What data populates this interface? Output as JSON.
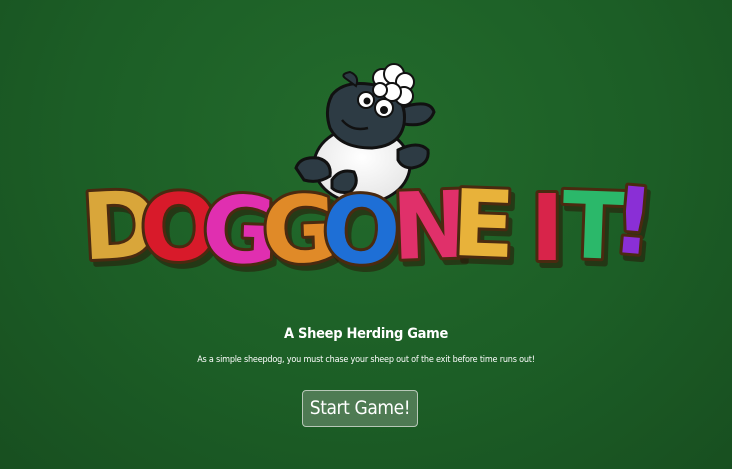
{
  "title": {
    "text": "DOGGONE IT!",
    "letters": [
      "D",
      "O",
      "G",
      "G",
      "O",
      "N",
      "E",
      "I",
      "T",
      "!"
    ],
    "letter_colors": [
      "#d9a63a",
      "#d81a2a",
      "#e02fb0",
      "#e08a28",
      "#1e6fd6",
      "#e0306a",
      "#e8b23a",
      "#d8244a",
      "#2bb86a",
      "#8a2fd6"
    ]
  },
  "subtitle": "A Sheep Herding Game",
  "description": "As a simple sheepdog, you must chase your sheep out of the exit before time runs out!",
  "start_button": {
    "label": "Start Game!"
  },
  "icons": {
    "mascot": "sheep-mascot-icon"
  },
  "colors": {
    "background": "#1f6128",
    "button_border": "#b8c8b8"
  }
}
